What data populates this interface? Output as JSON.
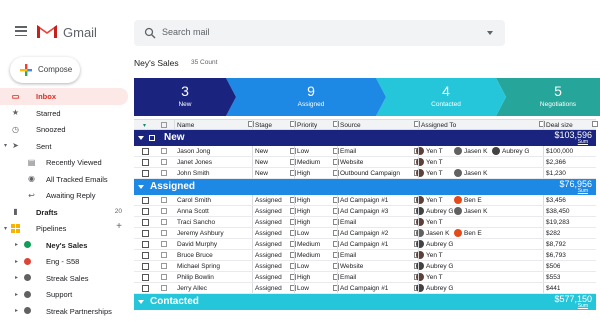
{
  "app": {
    "logo_text": "Gmail",
    "colors": {
      "active_bg": "#fce8e6",
      "active_text": "#d93025"
    }
  },
  "search": {
    "placeholder": "Search mail"
  },
  "compose": {
    "label": "Compose"
  },
  "sidebar": {
    "items": [
      {
        "label": "Inbox",
        "icon": "inbox-icon",
        "active": true
      },
      {
        "label": "Starred",
        "icon": "star-icon"
      },
      {
        "label": "Snoozed",
        "icon": "clock-icon"
      },
      {
        "label": "Sent",
        "icon": "send-icon"
      },
      {
        "label": "Recently Viewed",
        "icon": "chat-icon"
      },
      {
        "label": "All Tracked Emails",
        "icon": "eye-icon"
      },
      {
        "label": "Awaiting Reply",
        "icon": "reply-icon"
      },
      {
        "label": "Drafts",
        "icon": "draft-icon",
        "count": "20"
      },
      {
        "label": "Pipelines",
        "icon": "pipelines-icon"
      },
      {
        "label": "Ney's Sales",
        "icon": "pipeline-dot-icon",
        "color": "#0f9d58",
        "bold": true
      },
      {
        "label": "Eng - S58",
        "icon": "pipeline-dot-icon",
        "color": "#db4437"
      },
      {
        "label": "Streak Sales",
        "icon": "pipeline-dot-icon",
        "color": "#616161"
      },
      {
        "label": "Support",
        "icon": "pipeline-dot-icon",
        "color": "#616161"
      },
      {
        "label": "Streak Partnerships",
        "icon": "pipeline-dot-icon",
        "color": "#616161"
      }
    ]
  },
  "pipeline": {
    "title": "Ney's Sales",
    "count": "35 Count"
  },
  "stages": [
    {
      "num": "3",
      "label": "New",
      "color": "#1a237e"
    },
    {
      "num": "9",
      "label": "Assigned",
      "color": "#1e88e5"
    },
    {
      "num": "4",
      "label": "Contacted",
      "color": "#26c6da"
    },
    {
      "num": "5",
      "label": "Negotiations",
      "color": "#26a69a"
    }
  ],
  "columns": [
    "Name",
    "Stage",
    "Priority",
    "Source",
    "Assigned To",
    "Deal size"
  ],
  "groups": [
    {
      "name": "New",
      "total": "$103,596",
      "sum_label": "Sum",
      "color": "#1a237e",
      "rows": [
        {
          "name": "Jason Jong",
          "stage": "New",
          "priority": "Low",
          "source": "Email",
          "assigned": [
            "Yen T",
            "Jasen K",
            "Aubrey G"
          ],
          "deal": "$100,000"
        },
        {
          "name": "Janet Jones",
          "stage": "New",
          "priority": "Medium",
          "source": "Website",
          "assigned": [
            "Yen T"
          ],
          "deal": "$2,366"
        },
        {
          "name": "John Smith",
          "stage": "New",
          "priority": "High",
          "source": "Outbound Campaign",
          "assigned": [
            "Yen T",
            "Jasen K"
          ],
          "deal": "$1,230"
        }
      ]
    },
    {
      "name": "Assigned",
      "total": "$76,956",
      "sum_label": "Sum",
      "color": "#1e88e5",
      "rows": [
        {
          "name": "Carol Smith",
          "stage": "Assigned",
          "priority": "High",
          "source": "Ad Campaign #1",
          "assigned": [
            "Yen T",
            "Ben E"
          ],
          "deal": "$3,456"
        },
        {
          "name": "Anna Scott",
          "stage": "Assigned",
          "priority": "High",
          "source": "Ad Campaign #3",
          "assigned": [
            "Aubrey G",
            "Jasen K"
          ],
          "deal": "$38,450"
        },
        {
          "name": "Traci Sancho",
          "stage": "Assigned",
          "priority": "High",
          "source": "Email",
          "assigned": [
            "Yen T"
          ],
          "deal": "$19,283"
        },
        {
          "name": "Jeremy Ashbury",
          "stage": "Assigned",
          "priority": "Low",
          "source": "Ad Campaign #2",
          "assigned": [
            "Jasen K",
            "Ben E"
          ],
          "deal": "$282"
        },
        {
          "name": "David Murphy",
          "stage": "Assigned",
          "priority": "Medium",
          "source": "Ad Campaign #1",
          "assigned": [
            "Aubrey G"
          ],
          "deal": "$8,792"
        },
        {
          "name": "Bruce Bruce",
          "stage": "Assigned",
          "priority": "Medium",
          "source": "Email",
          "assigned": [
            "Yen T"
          ],
          "deal": "$6,793"
        },
        {
          "name": "Michael Spring",
          "stage": "Assigned",
          "priority": "Low",
          "source": "Website",
          "assigned": [
            "Aubrey G"
          ],
          "deal": "$506"
        },
        {
          "name": "Philip Bowlin",
          "stage": "Assigned",
          "priority": "High",
          "source": "Email",
          "assigned": [
            "Yen T"
          ],
          "deal": "$553"
        },
        {
          "name": "Jerry Allec",
          "stage": "Assigned",
          "priority": "Low",
          "source": "Ad Campaign #1",
          "assigned": [
            "Aubrey G"
          ],
          "deal": "$441"
        }
      ]
    },
    {
      "name": "Contacted",
      "total": "$577,150",
      "sum_label": "Sum",
      "color": "#26c6da",
      "rows": []
    }
  ],
  "avatar_colors": {
    "Yen T": "#5d4037",
    "Jasen K": "#616161",
    "Aubrey G": "#424242",
    "Ben E": "#e64a19"
  }
}
